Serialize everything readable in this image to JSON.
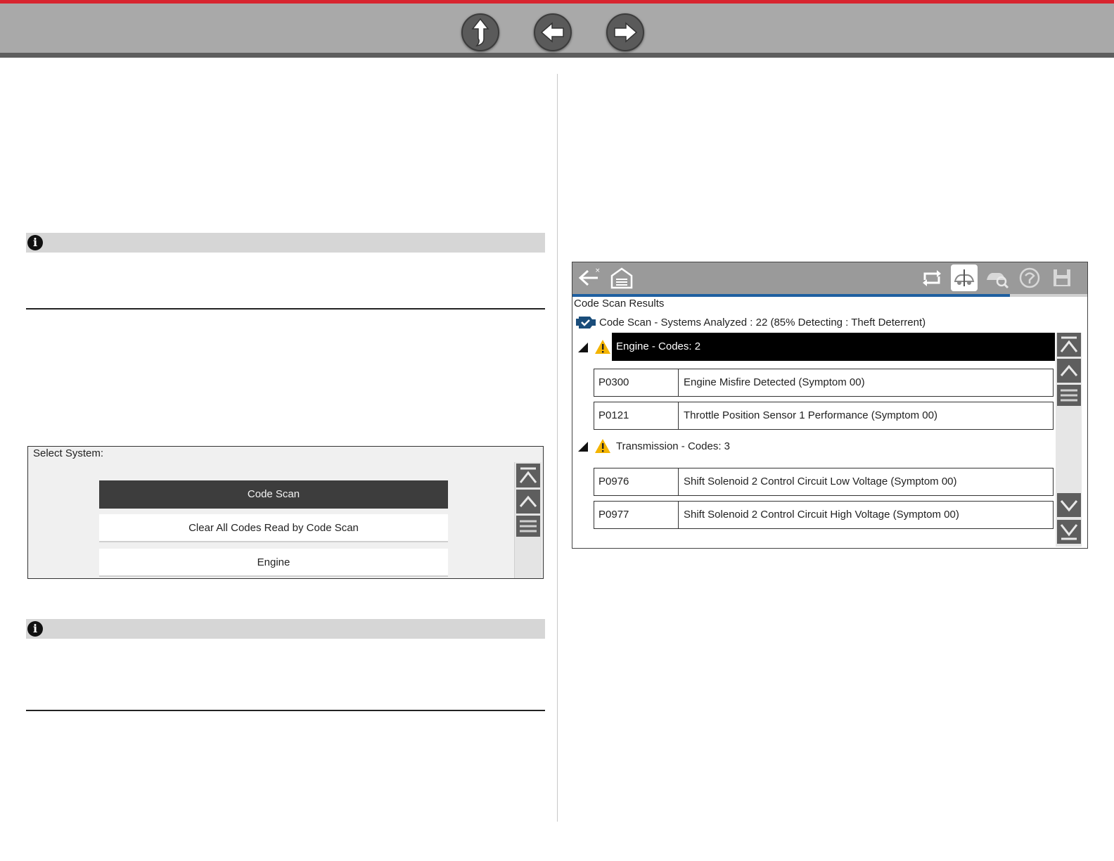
{
  "nav": {
    "buttons": [
      {
        "icon": "up-arrow-icon"
      },
      {
        "icon": "back-arrow-icon"
      },
      {
        "icon": "forward-arrow-icon"
      }
    ],
    "accent_color": "#d8252f"
  },
  "notes": [
    {
      "icon": "info-icon",
      "glyph": "i"
    },
    {
      "icon": "info-icon",
      "glyph": "i"
    }
  ],
  "select_system": {
    "title": "Select System:",
    "items": [
      "Code Scan",
      "Clear All Codes Read by Code Scan",
      "Engine"
    ],
    "selected_index": 0
  },
  "code_scan": {
    "title": "Code Scan Results",
    "summary": "Code Scan - Systems Analyzed : 22  (85% Detecting : Theft Deterrent)",
    "progress": 0.85,
    "toolbar": [
      "back-icon",
      "home-icon",
      "repeat-icon",
      "scan-vehicle-icon",
      "vehicle-search-icon",
      "freeze-frame-icon",
      "save-icon"
    ],
    "groups": [
      {
        "label": "Engine - Codes: 2",
        "selected": true,
        "codes": [
          {
            "code": "P0300",
            "desc": "Engine Misfire Detected (Symptom 00)"
          },
          {
            "code": "P0121",
            "desc": "Throttle Position Sensor 1 Performance (Symptom 00)"
          }
        ]
      },
      {
        "label": "Transmission - Codes: 3",
        "selected": false,
        "codes": [
          {
            "code": "P0976",
            "desc": "Shift Solenoid 2 Control Circuit Low Voltage (Symptom 00)"
          },
          {
            "code": "P0977",
            "desc": "Shift Solenoid 2 Control Circuit High Voltage (Symptom 00)"
          }
        ]
      }
    ]
  }
}
